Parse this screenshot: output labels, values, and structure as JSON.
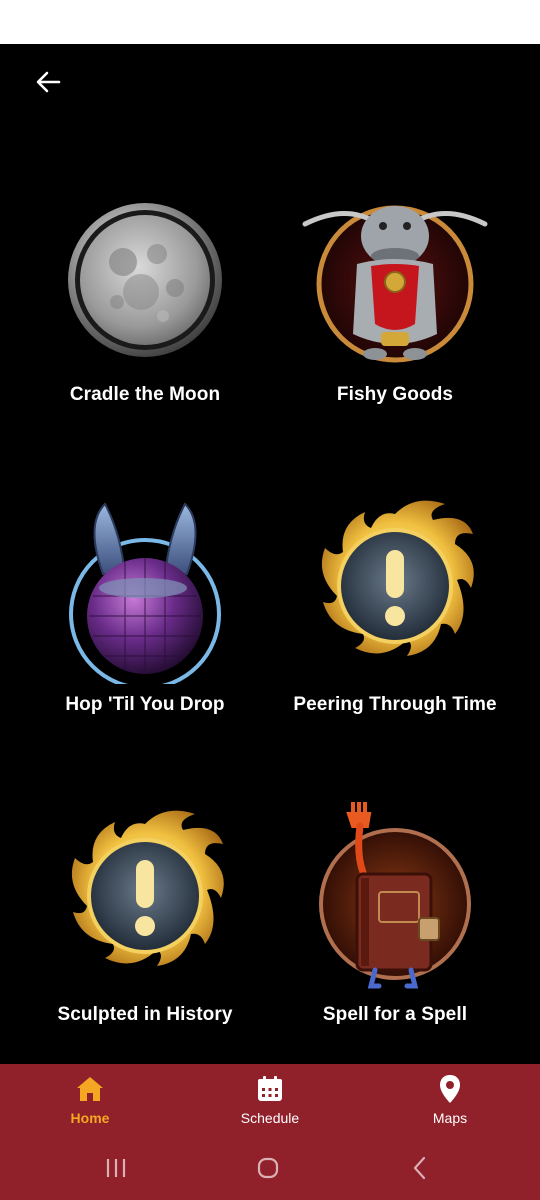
{
  "header": {
    "back_icon": "arrow-left-icon"
  },
  "quests": [
    {
      "title": "Cradle the Moon",
      "icon": "moon-medallion-icon"
    },
    {
      "title": "Fishy Goods",
      "icon": "namazu-icon"
    },
    {
      "title": "Hop 'Til You Drop",
      "icon": "disco-bunny-icon"
    },
    {
      "title": "Peering Through Time",
      "icon": "exclamation-quest-icon"
    },
    {
      "title": "Sculpted in History",
      "icon": "exclamation-quest-icon"
    },
    {
      "title": "Spell for a Spell",
      "icon": "spellbook-icon"
    }
  ],
  "nav": {
    "items": [
      {
        "label": "Home",
        "icon": "home-icon",
        "active": true
      },
      {
        "label": "Schedule",
        "icon": "calendar-icon",
        "active": false
      },
      {
        "label": "Maps",
        "icon": "map-pin-icon",
        "active": false
      }
    ]
  },
  "colors": {
    "background": "#000000",
    "nav_bar": "#90202a",
    "active": "#f5a623",
    "text": "#ffffff"
  }
}
